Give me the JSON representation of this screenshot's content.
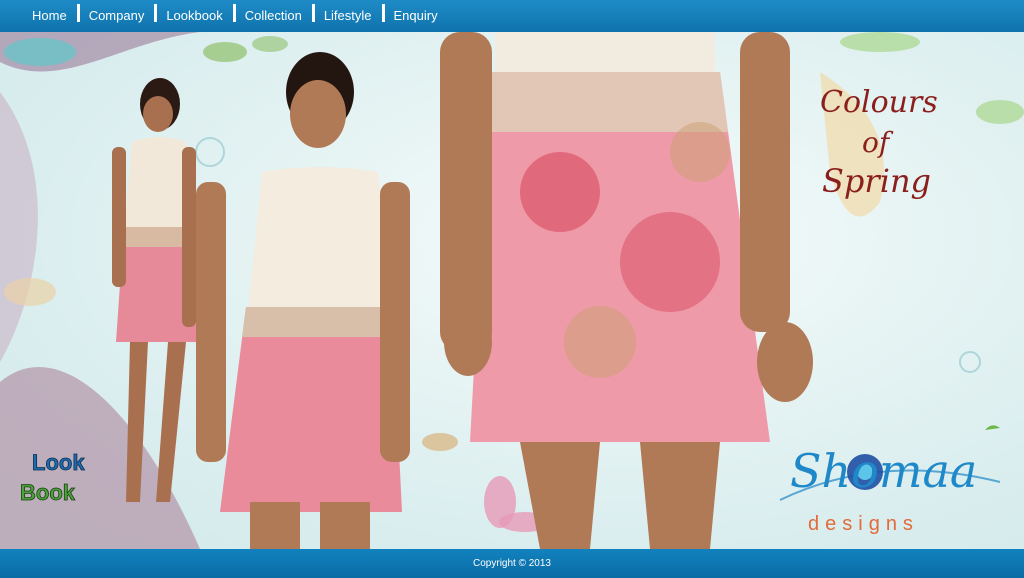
{
  "nav": {
    "items": [
      "Home",
      "Company",
      "Lookbook",
      "Collection",
      "Lifestyle",
      "Enquiry"
    ]
  },
  "hero": {
    "headline": [
      "Colours",
      "of",
      "Spring"
    ],
    "badge": [
      "Look",
      "Book"
    ],
    "brand_name": "Shomaa",
    "brand_sub": "designs",
    "colors": {
      "accent": "#8a1f1c",
      "brand_blue": "#1f88c8",
      "brand_orange": "#e36a3a"
    }
  },
  "footer": {
    "copyright": "Copyright © 2013"
  }
}
